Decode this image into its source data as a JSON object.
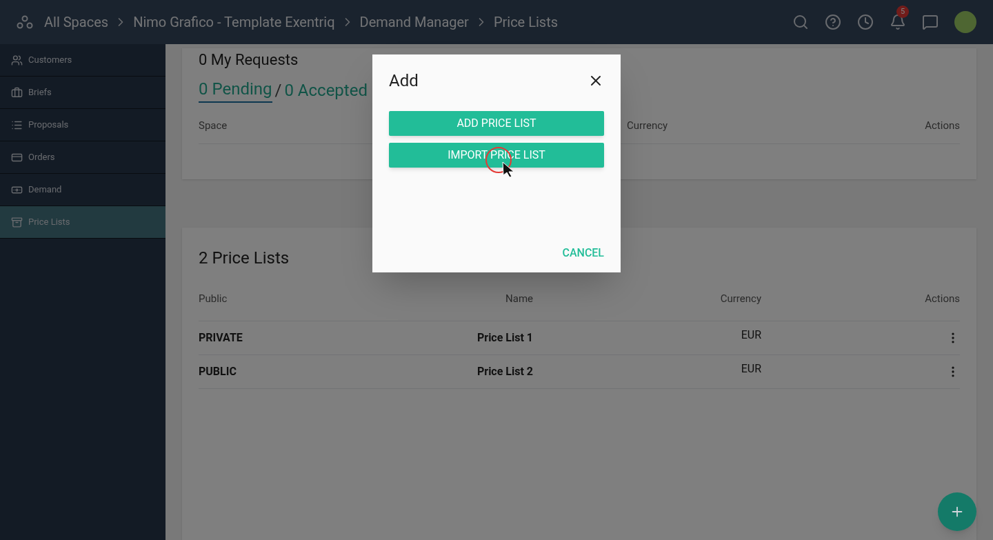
{
  "breadcrumb": [
    "All Spaces",
    "Nimo Grafico - Template Exentriq",
    "Demand Manager",
    "Price Lists"
  ],
  "header": {
    "notification_count": "5"
  },
  "sidebar": {
    "items": [
      {
        "label": "Customers",
        "selected": false
      },
      {
        "label": "Briefs",
        "selected": false
      },
      {
        "label": "Proposals",
        "selected": false
      },
      {
        "label": "Orders",
        "selected": false
      },
      {
        "label": "Demand",
        "selected": false
      },
      {
        "label": "Price Lists",
        "selected": true
      }
    ]
  },
  "requests": {
    "title": "0 My Requests",
    "tabs": [
      {
        "label": "0 Pending",
        "selected": true
      },
      {
        "label": "0 Accepted",
        "selected": false
      }
    ],
    "separator": "/",
    "columns": [
      "Space",
      "Currency",
      "Actions"
    ]
  },
  "price_lists": {
    "title": "2 Price Lists",
    "columns": [
      "Public",
      "Name",
      "Currency",
      "Actions"
    ],
    "rows": [
      {
        "public": "PRIVATE",
        "name": "Price List 1",
        "currency": "EUR"
      },
      {
        "public": "PUBLIC",
        "name": "Price List 2",
        "currency": "EUR"
      }
    ]
  },
  "dialog": {
    "title": "Add",
    "buttons": [
      "ADD PRICE LIST",
      "IMPORT PRICE LIST"
    ],
    "cancel": "CANCEL"
  }
}
